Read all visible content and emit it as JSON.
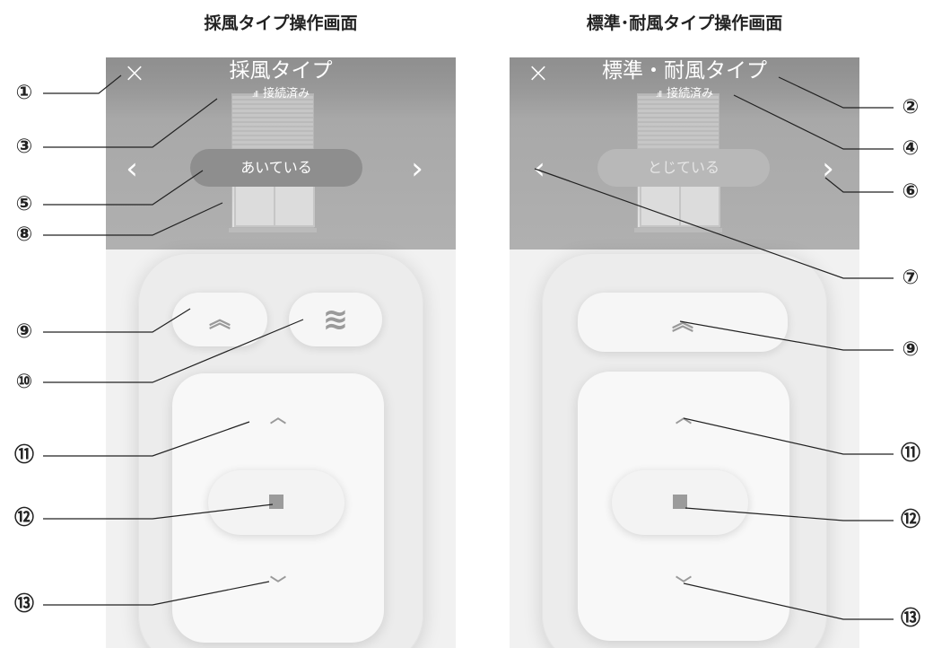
{
  "headings": {
    "left": "採風タイプ操作画面",
    "right": "標準･耐風タイプ操作画面"
  },
  "left_screen": {
    "close_icon": "×",
    "title": "採風タイプ",
    "signal_icon": ".ıll",
    "status": "接続済み",
    "state_label": "あいている",
    "prev_icon": "‹",
    "next_icon": "›",
    "up_full_icon": "︽",
    "ventilation_icon": "≋",
    "up_icon": "︿",
    "down_icon": "﹀"
  },
  "right_screen": {
    "close_icon": "×",
    "title": "標準・耐風タイプ",
    "signal_icon": ".ıll",
    "status": "接続済み",
    "state_label": "とじている",
    "prev_icon": "‹",
    "next_icon": "›",
    "up_full_icon": "︽",
    "up_icon": "︿",
    "down_icon": "﹀"
  },
  "callouts": {
    "left": [
      "①",
      "③",
      "⑤",
      "⑧",
      "⑨",
      "⑩",
      "⑪",
      "⑫",
      "⑬"
    ],
    "right": [
      "②",
      "④",
      "⑥",
      "⑦",
      "⑨",
      "⑪",
      "⑫",
      "⑬"
    ]
  }
}
